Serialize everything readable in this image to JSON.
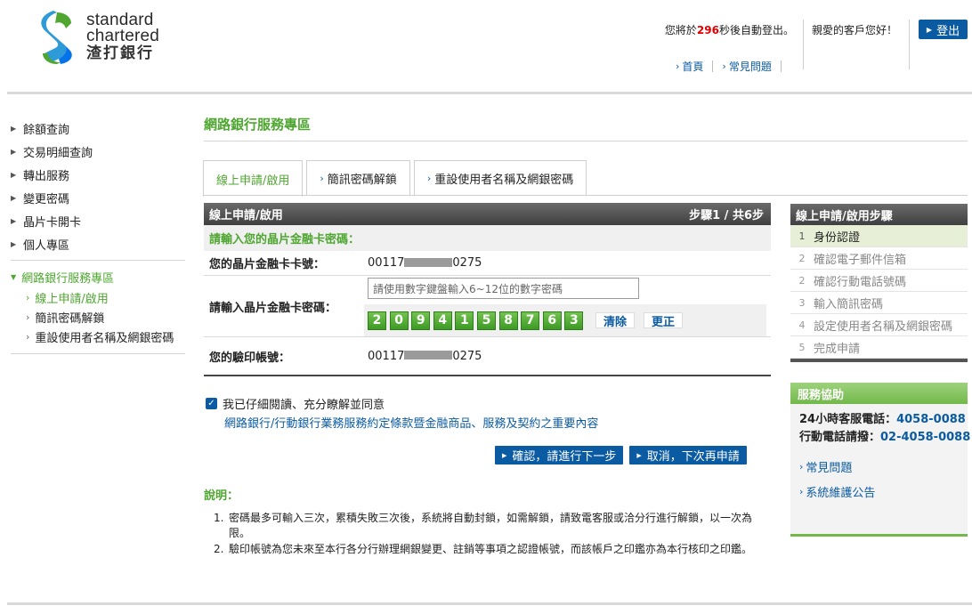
{
  "brand": {
    "line1": "standard",
    "line2": "chartered",
    "line3": "渣打銀行",
    "colors": {
      "blue": "#0b5ba3",
      "green": "#4fa631",
      "accent_green": "#72b84b"
    }
  },
  "header": {
    "session_prefix": "您將於",
    "session_seconds": "296",
    "session_suffix": "秒後自動登出。",
    "greeting": "親愛的客戶您好！",
    "logout_label": "登出",
    "links": [
      "首頁",
      "常見問題"
    ]
  },
  "sidebar": {
    "items": [
      "餘額查詢",
      "交易明細查詢",
      "轉出服務",
      "變更密碼",
      "晶片卡開卡",
      "個人專區"
    ],
    "section_label": "網路銀行服務專區",
    "sub_items": [
      "線上申請/啟用",
      "簡訊密碼解鎖",
      "重設使用者名稱及網銀密碼"
    ]
  },
  "main": {
    "title": "網路銀行服務專區",
    "tabs": [
      "線上申請/啟用",
      "簡訊密碼解鎖",
      "重設使用者名稱及網銀密碼"
    ],
    "form": {
      "header": "線上申請/啟用",
      "step_indicator": "步驟1 / 共6步",
      "hint": "請輸入您的晶片金融卡密碼：",
      "card_label": "您的晶片金融卡卡號：",
      "card_prefix": "00117",
      "card_suffix": "0275",
      "pin_label": "請輸入晶片金融卡密碼：",
      "pin_placeholder": "請使用數字鍵盤輸入6~12位的數字密碼",
      "keypad": [
        "2",
        "0",
        "9",
        "4",
        "1",
        "5",
        "8",
        "7",
        "6",
        "3"
      ],
      "clear_label": "清除",
      "correct_label": "更正",
      "account_label": "您的驗印帳號：",
      "account_prefix": "00117",
      "account_suffix": "0275"
    },
    "agree_label": "我已仔細閱讀、充分瞭解並同意",
    "agree_checked": true,
    "terms_link": "網路銀行/行動銀行業務服務約定條款暨金融商品、服務及契約之重要內容",
    "confirm_label": "確認，請進行下一步",
    "cancel_label": "取消，下次再申請",
    "notes_title": "說明：",
    "notes": [
      {
        "num": "1.",
        "text": "密碼最多可輸入三次，累積失敗三次後，系統將自動封鎖，如需解鎖，請致電客服或洽分行進行解鎖，以一次為限。"
      },
      {
        "num": "2.",
        "text": "驗印帳號為您未來至本行各分行辦理網銀變更、註銷等事項之認證帳號，而該帳戶之印鑑亦為本行核印之印鑑。"
      }
    ]
  },
  "steps": {
    "header": "線上申請/啟用步驟",
    "items": [
      {
        "num": "1",
        "label": "身份認證"
      },
      {
        "num": "2",
        "label": "確認電子郵件信箱"
      },
      {
        "num": "2",
        "label": "確認行動電話號碼"
      },
      {
        "num": "3",
        "label": "輸入簡訊密碼"
      },
      {
        "num": "4",
        "label": "設定使用者名稱及網銀密碼"
      },
      {
        "num": "5",
        "label": "完成申請"
      }
    ]
  },
  "help": {
    "header": "服務協助",
    "hotline_label": "24小時客服電話：",
    "hotline": "4058-0088",
    "mobile_label": "行動電話請撥：",
    "mobile": "02-4058-0088",
    "links": [
      "常見問題",
      "系統維護公告"
    ]
  }
}
